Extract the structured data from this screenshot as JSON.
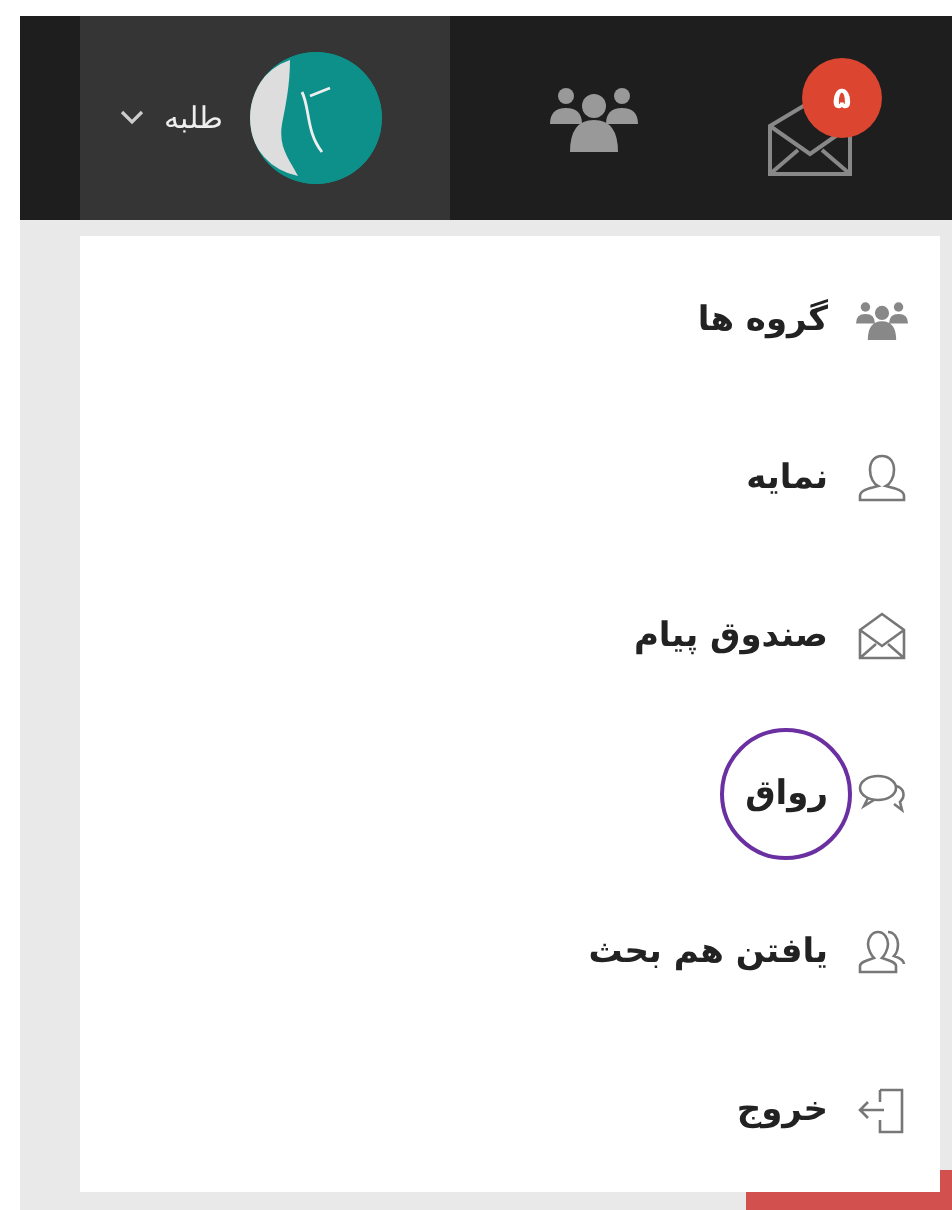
{
  "navbar": {
    "user": {
      "name": "طلبه"
    },
    "notifications": {
      "badge": "۵"
    }
  },
  "menu": {
    "items": [
      {
        "kind": "groups",
        "label": "گروه ها",
        "circled": false
      },
      {
        "kind": "profile",
        "label": "نمایه",
        "circled": false
      },
      {
        "kind": "inbox",
        "label": "صندوق پیام",
        "circled": false
      },
      {
        "kind": "forum",
        "label": "رواق",
        "circled": true
      },
      {
        "kind": "find",
        "label": "یافتن هم بحث",
        "circled": false
      },
      {
        "kind": "logout",
        "label": "خروج",
        "circled": false
      }
    ]
  }
}
